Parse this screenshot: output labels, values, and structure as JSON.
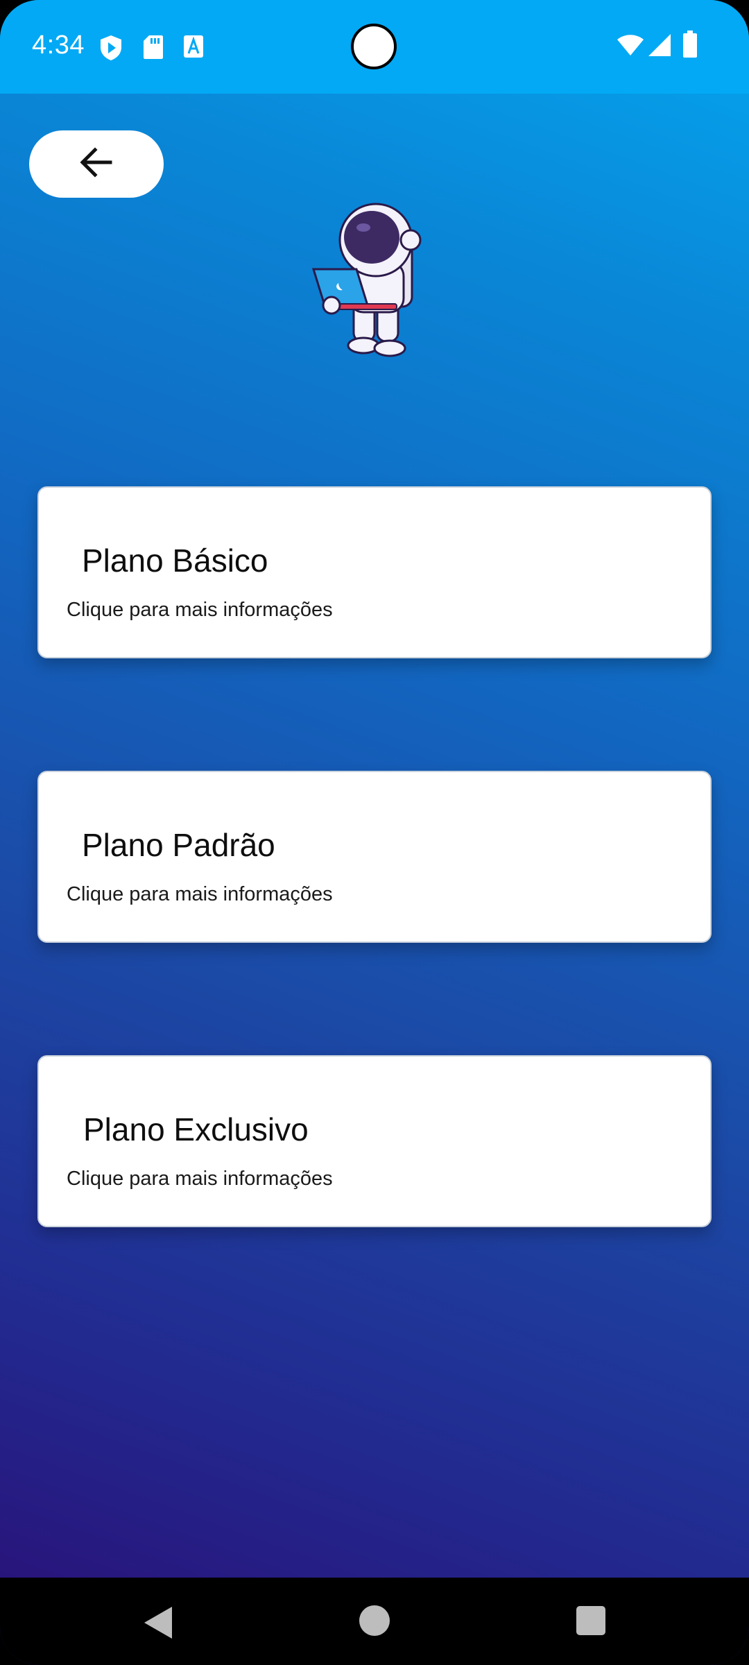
{
  "status_bar": {
    "time": "4:34",
    "background_color": "#03a9f4",
    "left_icons": [
      "shield-play-icon",
      "sd-card-icon",
      "text-a-icon"
    ],
    "right_icons": [
      "wifi-icon",
      "signal-icon",
      "battery-icon"
    ]
  },
  "header": {
    "back_icon": "arrow-left-icon",
    "mascot": "astronaut-laptop-illustration"
  },
  "plans": [
    {
      "title": "Plano Básico",
      "subtitle": "Clique para mais informações"
    },
    {
      "title": "Plano Padrão",
      "subtitle": "Clique para mais informações"
    },
    {
      "title": "Plano Exclusivo",
      "subtitle": "Clique para mais informações"
    }
  ],
  "nav_bar": {
    "buttons": [
      "back-triangle-icon",
      "home-circle-icon",
      "recents-square-icon"
    ]
  },
  "colors": {
    "gradient_top": "#04a6ef",
    "gradient_bottom": "#2a0e75",
    "card": "#ffffff"
  }
}
